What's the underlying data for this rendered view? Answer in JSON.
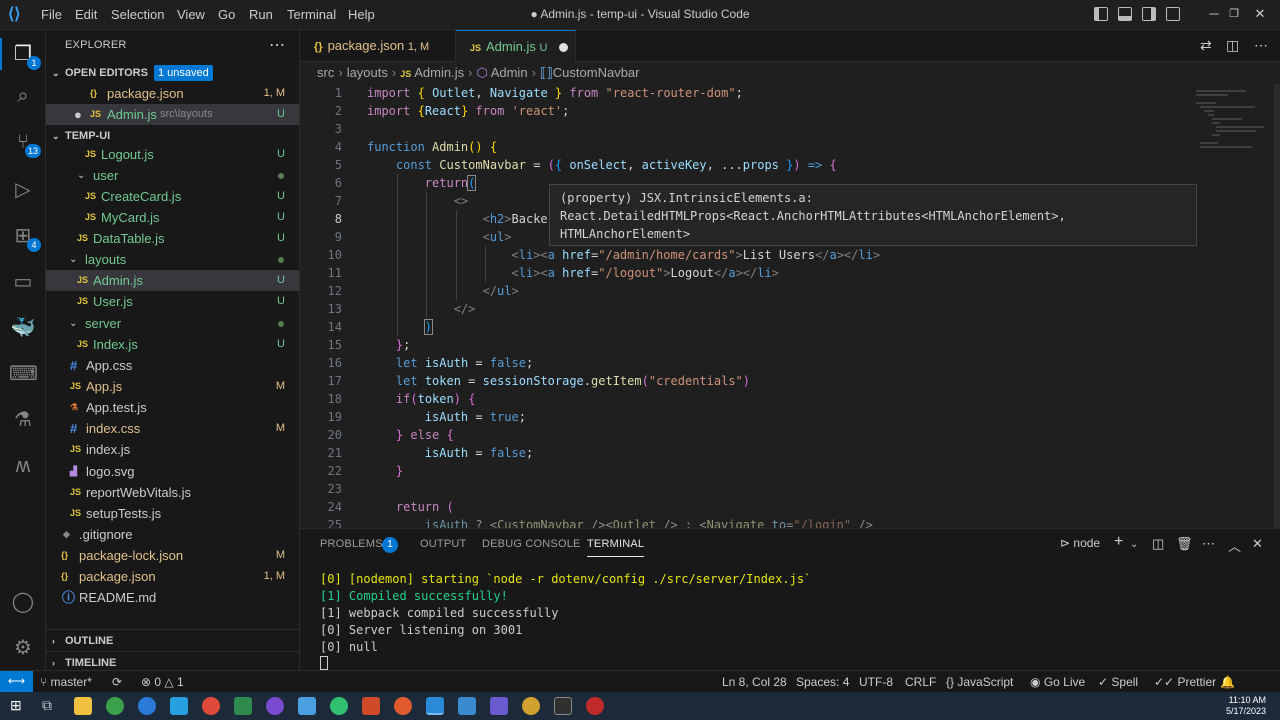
{
  "titlebar": {
    "menus": [
      "File",
      "Edit",
      "Selection",
      "View",
      "Go",
      "Run",
      "Terminal",
      "Help"
    ],
    "title": "● Admin.js - temp-ui - Visual Studio Code"
  },
  "sidebar": {
    "header": "EXPLORER",
    "open_editors": {
      "label": "OPEN EDITORS",
      "badge": "1 unsaved"
    },
    "open_files": [
      {
        "name": "package.json",
        "status": "1, M"
      },
      {
        "name": "Admin.js",
        "path": "src\\layouts",
        "status": "U"
      }
    ],
    "project": "TEMP-UI",
    "tree": [
      {
        "name": "Logout.js",
        "status": "U"
      },
      {
        "name": "user"
      },
      {
        "name": "CreateCard.js",
        "status": "U"
      },
      {
        "name": "MyCard.js",
        "status": "U"
      },
      {
        "name": "DataTable.js",
        "status": "U"
      },
      {
        "name": "layouts"
      },
      {
        "name": "Admin.js",
        "status": "U"
      },
      {
        "name": "User.js",
        "status": "U"
      },
      {
        "name": "server"
      },
      {
        "name": "Index.js",
        "status": "U"
      },
      {
        "name": "App.css"
      },
      {
        "name": "App.js",
        "status": "M"
      },
      {
        "name": "App.test.js"
      },
      {
        "name": "index.css",
        "status": "M"
      },
      {
        "name": "index.js"
      },
      {
        "name": "logo.svg"
      },
      {
        "name": "reportWebVitals.js"
      },
      {
        "name": "setupTests.js"
      },
      {
        "name": ".gitignore"
      },
      {
        "name": "package-lock.json",
        "status": "M"
      },
      {
        "name": "package.json",
        "status": "1, M"
      },
      {
        "name": "README.md"
      }
    ],
    "outline": "OUTLINE",
    "timeline": "TIMELINE"
  },
  "activity_badges": {
    "source_control": "13",
    "extensions": "4",
    "explorer": "1"
  },
  "tabs": [
    {
      "label": "package.json",
      "status": "1, M"
    },
    {
      "label": "Admin.js",
      "status": "U"
    }
  ],
  "breadcrumb": [
    "src",
    "layouts",
    "Admin.js",
    "Admin",
    "CustomNavbar"
  ],
  "editor": {
    "line_numbers": [
      "1",
      "2",
      "3",
      "4",
      "5",
      "6",
      "7",
      "8",
      "9",
      "10",
      "11",
      "12",
      "13",
      "14",
      "15",
      "16",
      "17",
      "18",
      "19",
      "20",
      "21",
      "22",
      "23",
      "24",
      "25"
    ],
    "current_line": "8",
    "hover_lines": [
      "(property) JSX.IntrinsicElements.a:",
      "React.DetailedHTMLProps<React.AnchorHTMLAttributes<HTMLAnchorElement>,",
      "HTMLAnchorElement>"
    ]
  },
  "panel": {
    "tabs": [
      "PROBLEMS",
      "OUTPUT",
      "DEBUG CONSOLE",
      "TERMINAL"
    ],
    "problems_count": "1",
    "terminal_name": "node",
    "terminal_lines": [
      "[0] [nodemon] starting `node -r dotenv/config ./src/server/Index.js`",
      "[1] Compiled successfully!",
      "[1] webpack compiled successfully",
      "[0] Server listening on 3001",
      "[0] null"
    ]
  },
  "statusbar": {
    "branch": "master*",
    "problems": "0",
    "warnings": "1",
    "position": "Ln 8, Col 28",
    "spaces": "Spaces: 4",
    "encoding": "UTF-8",
    "eol": "CRLF",
    "language": "JavaScript",
    "golive": "Go Live",
    "spell": "Spell",
    "prettier": "Prettier"
  },
  "taskbar": {
    "time": "11:10 AM",
    "date": "5/17/2023"
  },
  "colors": {
    "accent": "#0078d4",
    "untracked": "#73c991",
    "modified": "#e2c08d"
  }
}
